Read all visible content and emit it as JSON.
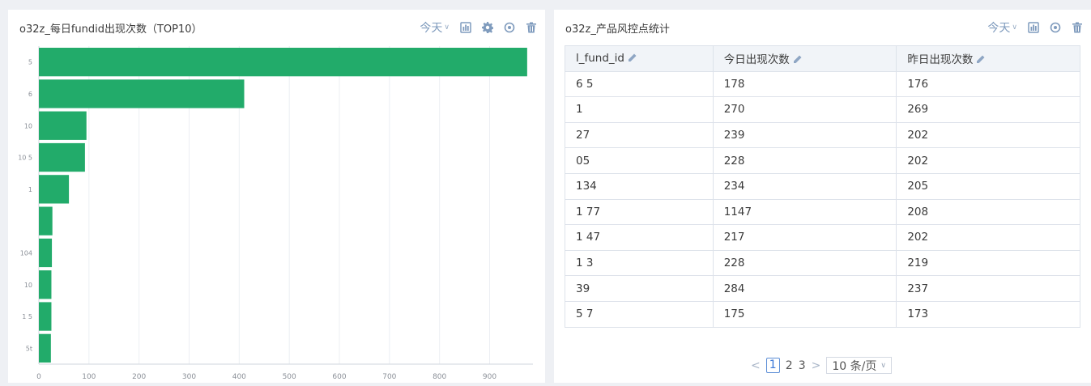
{
  "left_panel": {
    "title": "o32z_每日fundid出现次数（TOP10）",
    "range_label": "今天",
    "icons": [
      "bar-chart-icon",
      "gear-icon",
      "target-icon",
      "trash-icon"
    ]
  },
  "right_panel": {
    "title": "o32z_产品风控点统计",
    "range_label": "今天",
    "icons": [
      "bar-chart-icon",
      "target-icon",
      "trash-icon"
    ],
    "columns": [
      "l_fund_id",
      "今日出现次数",
      "昨日出现次数"
    ],
    "rows": [
      {
        "id_visible": "6 5",
        "today": "178",
        "yesterday": "176"
      },
      {
        "id_visible": "1",
        "today": "270",
        "yesterday": "269"
      },
      {
        "id_visible": "27",
        "today": "239",
        "yesterday": "202"
      },
      {
        "id_visible": "05",
        "today": "228",
        "yesterday": "202"
      },
      {
        "id_visible": "134",
        "today": "234",
        "yesterday": "205"
      },
      {
        "id_visible": "1 77",
        "today": "1147",
        "yesterday": "208"
      },
      {
        "id_visible": "1 47",
        "today": "217",
        "yesterday": "202"
      },
      {
        "id_visible": "1 3",
        "today": "228",
        "yesterday": "219"
      },
      {
        "id_visible": "39",
        "today": "284",
        "yesterday": "237"
      },
      {
        "id_visible": "5 7",
        "today": "175",
        "yesterday": "173"
      }
    ],
    "pagination": {
      "prev": "<",
      "pages": [
        "1",
        "2",
        "3"
      ],
      "current": "1",
      "next": ">",
      "page_size": "10 条/页"
    }
  },
  "colors": {
    "bar": "#22ab6a",
    "accent": "#7f9bbd",
    "grid": "#eceff3"
  },
  "chart_data": {
    "type": "bar",
    "orientation": "horizontal",
    "title": "o32z_每日fundid出现次数（TOP10）",
    "categories": [
      "5",
      "6",
      "10",
      "10 5",
      "1",
      "",
      "104",
      "10",
      "1 5",
      "5t"
    ],
    "values": [
      975,
      410,
      95,
      92,
      60,
      27,
      26,
      25,
      25,
      24
    ],
    "xlim": [
      0,
      980
    ],
    "x_ticks": [
      0,
      100,
      200,
      300,
      400,
      500,
      600,
      700,
      800,
      900
    ],
    "grid": true,
    "legend": "none"
  }
}
